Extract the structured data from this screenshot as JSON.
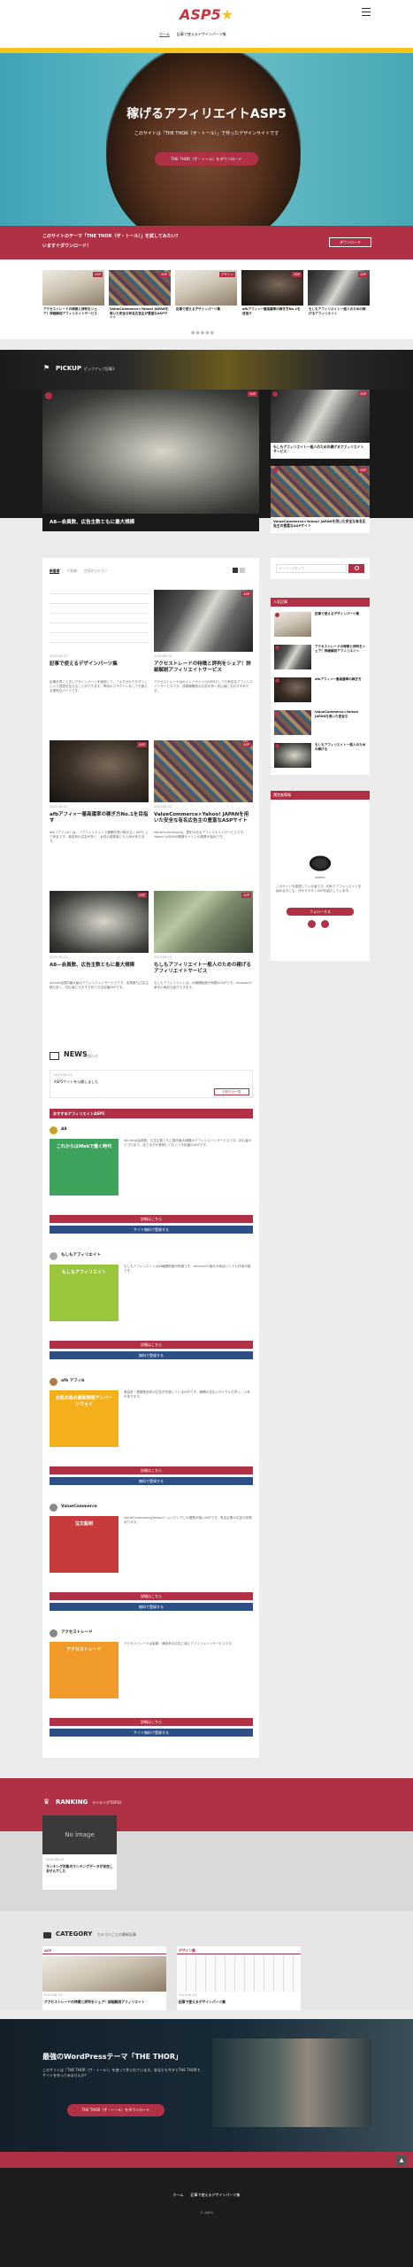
{
  "header": {
    "logo": "ASP5",
    "nav": [
      "ホーム",
      "記事で使えるデザインパーツ集"
    ],
    "menu_icon": "hamburger-icon"
  },
  "hero": {
    "title": "稼げるアフィリエイトASP5",
    "subtitle": "このサイトは「THE THOR（ザ・トール）」で作ったデザインサイトです",
    "button": "THE THOR（ザ・トール）をダウンロード"
  },
  "banner": {
    "line1": "このサイトのテーマ「THE THOR（ザ・トール）」を試してみたい？",
    "line2": "いますぐダウンロード！",
    "button": "ダウンロード"
  },
  "carousel": [
    {
      "title": "アクセストレードの特徴と評判をシェア！詳細解説アフィリエイトサービス",
      "tag": "ASP"
    },
    {
      "title": "ValueCommerce×Yahoo! JAPANを用いた安全な有名広告主が豊富なASPサイト",
      "tag": "ASP"
    },
    {
      "title": "記事で使えるデザインパーツ集",
      "tag": "デザイン"
    },
    {
      "title": "afbアフィ×一番高還率の稼ぎ方No.1を目指す",
      "tag": "ASP"
    },
    {
      "title": "もしもアフィリエイト一般人のための稼げるアフィリエイト",
      "tag": "ASP"
    }
  ],
  "pickup": {
    "title": "PICKUP",
    "subtitle": "ピックアップ記事3",
    "main_caption": "A8—会員数、広告主数ともに最大規模",
    "side": [
      "もしもアフィリエイト一般人のための稼げるアフィリエイトサービス",
      "ValueCommerce×Yahoo! JAPANを用いた安全な有名広告主の豊富なASPサイト"
    ],
    "tag": "ASP"
  },
  "articles": {
    "tabs": [
      "新着順",
      "人気順",
      "注目のカテゴリ"
    ],
    "items": [
      {
        "date": "2019.06.23",
        "title": "記事で使えるデザインパーツ集",
        "excerpt": "記事を書くときにデザインパーツを使用して、「より分かりやすく」という意図を伝えることができます。専用のプラグインなしでも使える便利なパーツです。",
        "tag": ""
      },
      {
        "date": "2019.06.23",
        "title": "アクセストレードの特徴と評判をシェア！詳細解説アフィリエイトサービス",
        "excerpt": "アクセストレードはポイントサイトのOEMとしても有名なアフィリエイトサービスです。成果報酬型の広告が多く初心者にもおすすめです。",
        "tag": "ASP"
      },
      {
        "date": "2019.06.23",
        "title": "afbアフィ×一番高還率の稼ぎ方No.1を目指す",
        "excerpt": "afb（アフィb）は、「アフィリエイトで報酬を受け取れる」ASPとして有名です。美容系の広告が多く、女性の運営者にも人気があります。",
        "tag": "ASP"
      },
      {
        "date": "2019.06.23",
        "title": "ValueCommerce×Yahoo! JAPANを用いた安全な有名広告主の豊富なASPサイト",
        "excerpt": "ValueCommerceは、歴史のあるアフィリエイトサービスです。Yahoo! JAPANの関連サイトとの連携が強みです。",
        "tag": "ASP"
      },
      {
        "date": "2019.06.23",
        "title": "A8—会員数、広告主数ともに最大規模",
        "excerpt": "A8.netは国内最大級のアフィリエイトサービスです。会員数も広告主数も多く、初心者にもおすすめできる定番ASPです。",
        "tag": "ASP"
      },
      {
        "date": "2019.06.23",
        "title": "もしもアフィリエイト一般人のための稼げるアフィリエイトサービス",
        "excerpt": "もしもアフィリエイトは、W報酬制度が特徴のASPです。Amazonや楽天の商品も紹介できます。",
        "tag": "ASP"
      }
    ]
  },
  "news": {
    "title": "NEWS",
    "subtitle": "お知らせ",
    "date": "2019.06.23",
    "item": "ASP5サイトを公開しました",
    "more": "お知らせ一覧"
  },
  "ranking_box": {
    "header": "おすすめアフィリエイトASP5",
    "items": [
      {
        "name": "A8",
        "desc": "A8.netは会員数、広告主数ともに国内最大規模のアフィリエイトサービスです。初心者からプロまで、全ての方が登録しておくべき定番のASPです。",
        "banner": "これからはWebで働く時代",
        "btn1": "詳細はこちら",
        "btn2": "サイト無料で登録する"
      },
      {
        "name": "もしもアフィリエイト",
        "desc": "もしもアフィリエイトはW報酬制度が特徴です。Amazonや楽天の商品リンクも作成可能です。",
        "banner": "もしもアフィリエイト",
        "btn1": "詳細はこちら",
        "btn2": "無料で登録する"
      },
      {
        "name": "afb アフィb",
        "desc": "美容系・健康食品系の広告が充実しているASPです。報酬の支払いサイクルも早く、人気があります。",
        "banner": "お肌の為の最新情報アンバーンウェイ",
        "btn1": "詳細はこちら",
        "btn2": "無料で登録する"
      },
      {
        "name": "ValueCommerce",
        "desc": "ValueCommerceはYahoo!ショッピングとの連携が強いASPです。有名企業の広告が多数あります。",
        "banner": "注文殺到",
        "btn1": "詳細はこちら",
        "btn2": "無料で登録する"
      },
      {
        "name": "アクセストレード",
        "desc": "アクセストレードは金融・通信系の広告に強いアフィリエイトサービスです。",
        "banner": "アクセストレード",
        "btn1": "詳細はこちら",
        "btn2": "サイト無料で登録する"
      }
    ]
  },
  "sidebar": {
    "search_placeholder": "キーワードを入力",
    "popular_title": "人気記事",
    "popular": [
      "記事で使えるデザインパーツ集",
      "アクセストレードの特徴と評判をシェア！詳細解説アフィリエイト",
      "afbアフィ×一番高還率の稼ぎ方",
      "ValueCommerce×Yahoo! JAPANを用いた安全な",
      "もしもアフィリエイト一般人のための稼げる"
    ],
    "profile_title": "運営者情報",
    "profile_name": "admin",
    "profile_text": "このサイトを運営している者です。初めてアフィリエイトを始める方にも、分かりやすくASPを紹介しています。",
    "follow_btn": "フォローする"
  },
  "ranking": {
    "title": "RANKING",
    "subtitle": "ランキングTOP10",
    "noimage": "No image",
    "item_date": "2019.06.23",
    "item": "ランキング対象のランキングデータが存在しませんでした"
  },
  "category": {
    "title": "CATEGORY",
    "subtitle": "カテゴリごとの最新記事",
    "cat1": "ASP",
    "cat2": "デザイン集",
    "item1": "アクセストレードの特徴と評判をシェア！詳細解説アフィリエイト",
    "item2": "記事で使えるデザインパーツ集",
    "date": "2019.06.23"
  },
  "cta": {
    "title": "最強のWordPressテーマ「THE THOR」",
    "text": "このサイトは「THE THOR（ザ・トール）」を使って作られています。あなたも今すぐTHE THORでサイトを作ってみませんか？",
    "button": "THE THOR（ザ・トール）をダウンロード"
  },
  "footer": {
    "nav": [
      "ホーム",
      "記事で使えるデザインパーツ集"
    ],
    "copyright": "© ASP5"
  },
  "colors": {
    "accent": "#b03045",
    "blue": "#2e4f86",
    "yellow": "#f4c41a"
  }
}
